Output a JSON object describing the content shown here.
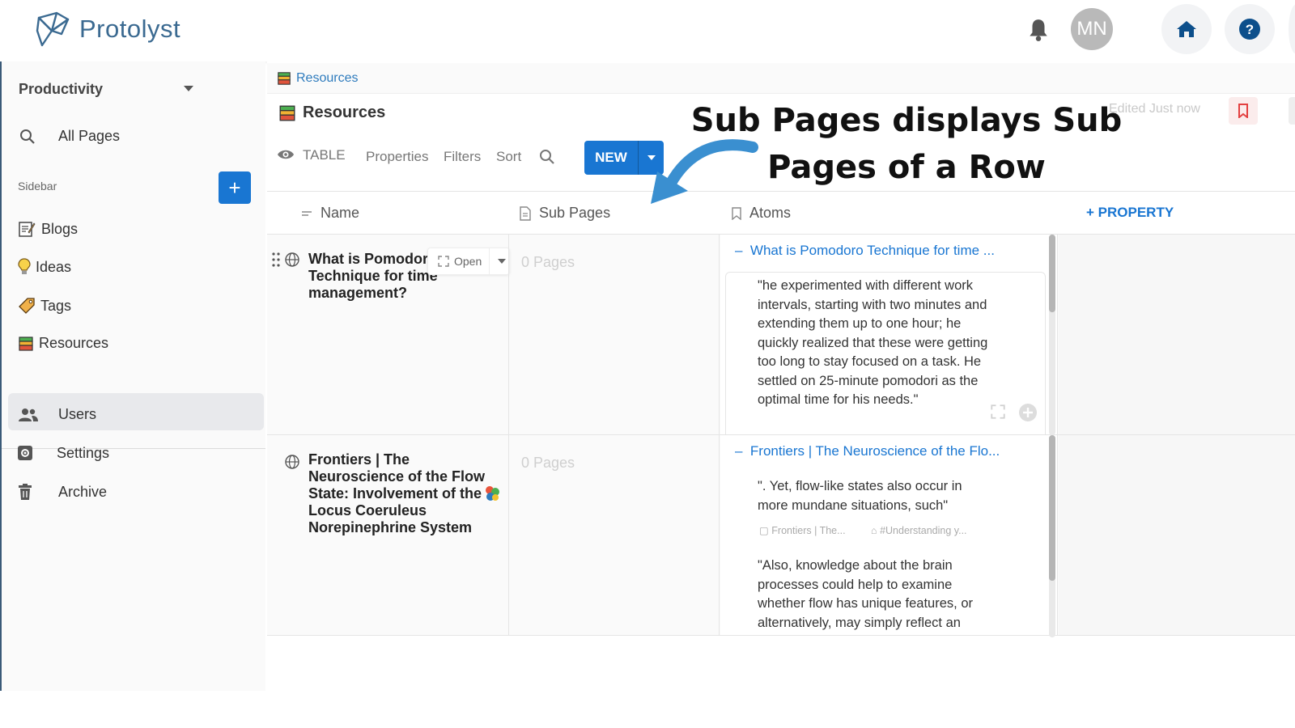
{
  "app": {
    "name": "Protolyst"
  },
  "header": {
    "avatar_initials": "MN"
  },
  "sidebar": {
    "workspace": "Productivity",
    "all_pages": "All Pages",
    "section_label": "Sidebar",
    "add_label": "+",
    "items": [
      {
        "label": "Blogs",
        "icon": "blog-icon"
      },
      {
        "label": "Ideas",
        "icon": "bulb-icon"
      },
      {
        "label": "Tags",
        "icon": "tag-icon"
      },
      {
        "label": "Resources",
        "icon": "books-icon",
        "active": true
      }
    ],
    "bottom_items": [
      {
        "label": "Users",
        "icon": "users-icon"
      },
      {
        "label": "Settings",
        "icon": "settings-icon"
      },
      {
        "label": "Archive",
        "icon": "archive-icon"
      }
    ]
  },
  "main": {
    "breadcrumb": "Resources",
    "title": "Resources",
    "edited": "Edited Just now",
    "toolbar": {
      "view": "TABLE",
      "properties": "Properties",
      "filters": "Filters",
      "sort": "Sort",
      "new": "NEW"
    },
    "columns": {
      "name": "Name",
      "sub_pages": "Sub Pages",
      "atoms": "Atoms",
      "add_property": "+ PROPERTY"
    },
    "rows": [
      {
        "name": "What is Pomodoro Technique for time management?",
        "name_lines": [
          "What is Pomodoro",
          "Technique for time",
          "management?"
        ],
        "open_label": "Open",
        "sub_pages": "0 Pages",
        "atom_title": "What is Pomodoro Technique for time ...",
        "atom_quote": "\"he experimented with different work intervals, starting with two minutes and extending them up to one hour; he quickly realized that these were getting too long to stay focused on a task. He settled on 25-minute pomodori as the optimal time for his needs.\""
      },
      {
        "name": "Frontiers | The Neuroscience of the Flow State: Involvement of the Locus Coeruleus Norepinephrine System",
        "name_lines": [
          "Frontiers | The",
          "Neuroscience of the Flow",
          "State: Involvement of the",
          "Locus Coeruleus",
          "Norepinephrine System"
        ],
        "sub_pages": "0 Pages",
        "atom_title": "Frontiers | The Neuroscience of the Flo...",
        "atom_quote_1": "\". Yet, flow-like states also occur in more mundane situations, such\"",
        "atom_meta_1": "Frontiers | The...",
        "atom_meta_2": "#Understanding y...",
        "atom_quote_2": "\"Also, knowledge about the brain processes could help to examine whether flow has unique features, or alternatively, may simply reflect an"
      }
    ]
  },
  "annotation": {
    "line1": "Sub Pages displays Sub",
    "line2": "Pages of a Row"
  },
  "colors": {
    "accent": "#1976d2",
    "logo": "#3b6a91",
    "annotation_arrow": "#3a8fd0"
  }
}
